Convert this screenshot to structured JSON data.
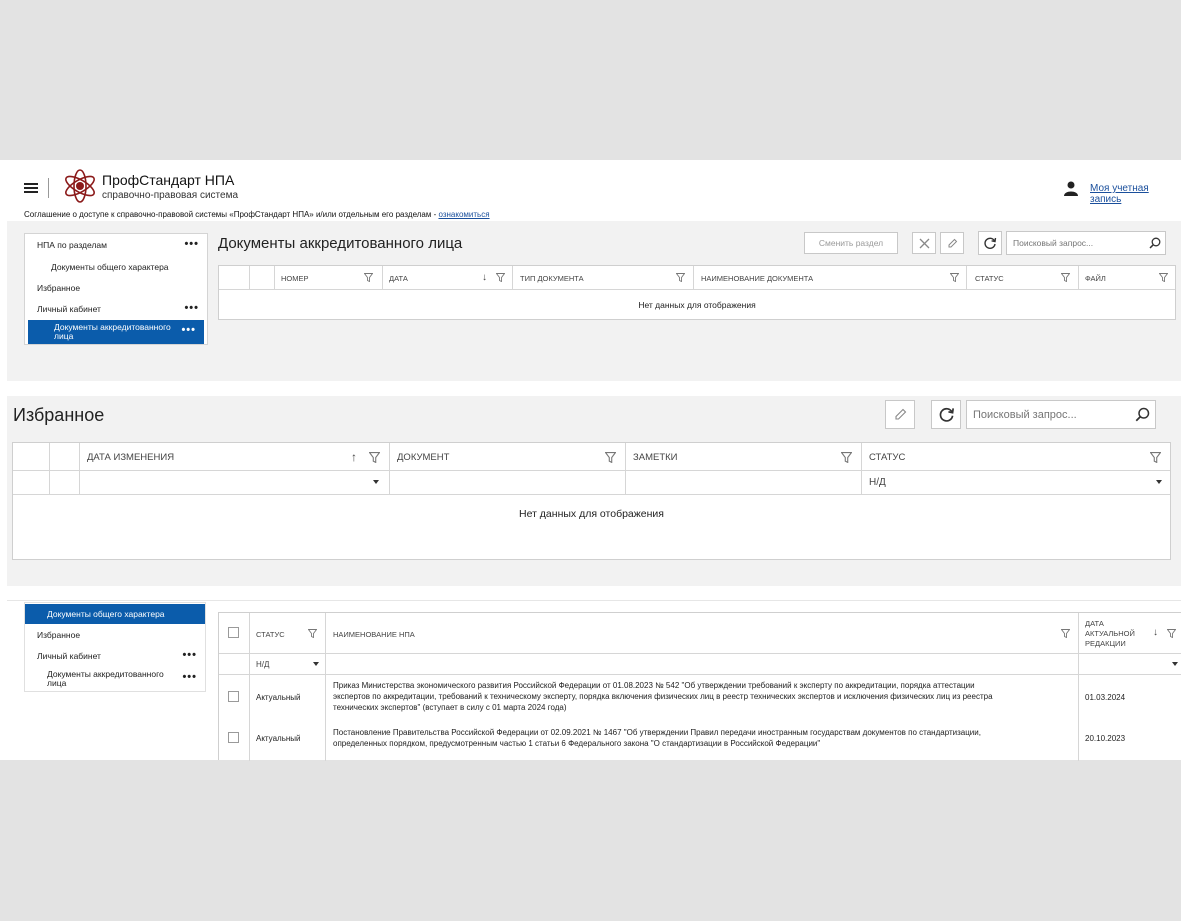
{
  "header": {
    "brand": "ПрофСтандарт НПА",
    "brand_sub": "справочно-правовая система",
    "account_link": "Моя учетная запись",
    "agreement_text": "Соглашение о доступе к справочно-правовой системы «ПрофСтандарт НПА» и/или отдельным его разделам - ",
    "agreement_link": "ознакомиться"
  },
  "sidebar1": {
    "items": [
      {
        "label": "НПА по разделам",
        "dots": "•••"
      },
      {
        "label": "Документы общего характера"
      },
      {
        "label": "Избранное"
      },
      {
        "label": "Личный кабинет",
        "dots": "•••"
      },
      {
        "label": "Документы аккредитованного лица",
        "dots": "•••"
      }
    ]
  },
  "section1": {
    "title": "Документы аккредитованного лица",
    "change_section_button": "Сменить раздел",
    "search_placeholder": "Поисковый запрос...",
    "columns": [
      "НОМЕР",
      "ДАТА",
      "ТИП ДОКУМЕНТА",
      "НАИМЕНОВАНИЕ ДОКУМЕНТА",
      "СТАТУС",
      "ФАЙЛ"
    ],
    "sort_arrow": "↓",
    "no_data": "Нет данных для отображения"
  },
  "section2": {
    "title": "Избранное",
    "search_placeholder": "Поисковый запрос...",
    "columns": [
      "ДАТА ИЗМЕНЕНИЯ",
      "ДОКУМЕНТ",
      "ЗАМЕТКИ",
      "СТАТУС"
    ],
    "sort_arrow": "↑",
    "status_filter_value": "Н/Д",
    "no_data": "Нет данных для отображения"
  },
  "sidebar3": {
    "items": [
      {
        "label": "Документы общего характера"
      },
      {
        "label": "Избранное"
      },
      {
        "label": "Личный кабинет",
        "dots": "•••"
      },
      {
        "label": "Документы аккредитованного лица",
        "dots": "•••"
      }
    ]
  },
  "section3": {
    "columns": [
      "СТАТУС",
      "НАИМЕНОВАНИЕ НПА",
      "ДАТА АКТУАЛЬНОЙ РЕДАКЦИИ"
    ],
    "sort_arrow": "↓",
    "status_filter_value": "Н/Д",
    "rows": [
      {
        "status": "Актуальный",
        "name_lines": [
          "Приказ Министерства экономического развития Российской Федерации от 01.08.2023 № 542 \"Об утверждении требований к эксперту по аккредитации, порядка аттестации",
          "экспертов по аккредитации, требований к техническому эксперту, порядка включения физических лиц в реестр технических экспертов и исключения физических лиц из реестра",
          "технических экспертов\" (вступает в силу с 01 марта 2024 года)"
        ],
        "date": "01.03.2024"
      },
      {
        "status": "Актуальный",
        "name_lines": [
          "Постановление Правительства Российской Федерации от 02.09.2021 № 1467 \"Об утверждении Правил передачи иностранным государствам документов по стандартизации,",
          "определенных порядком, предусмотренным частью 1 статьи 6 Федерального закона \"О стандартизации в Российской Федерации\""
        ],
        "date": "20.10.2023"
      }
    ]
  }
}
